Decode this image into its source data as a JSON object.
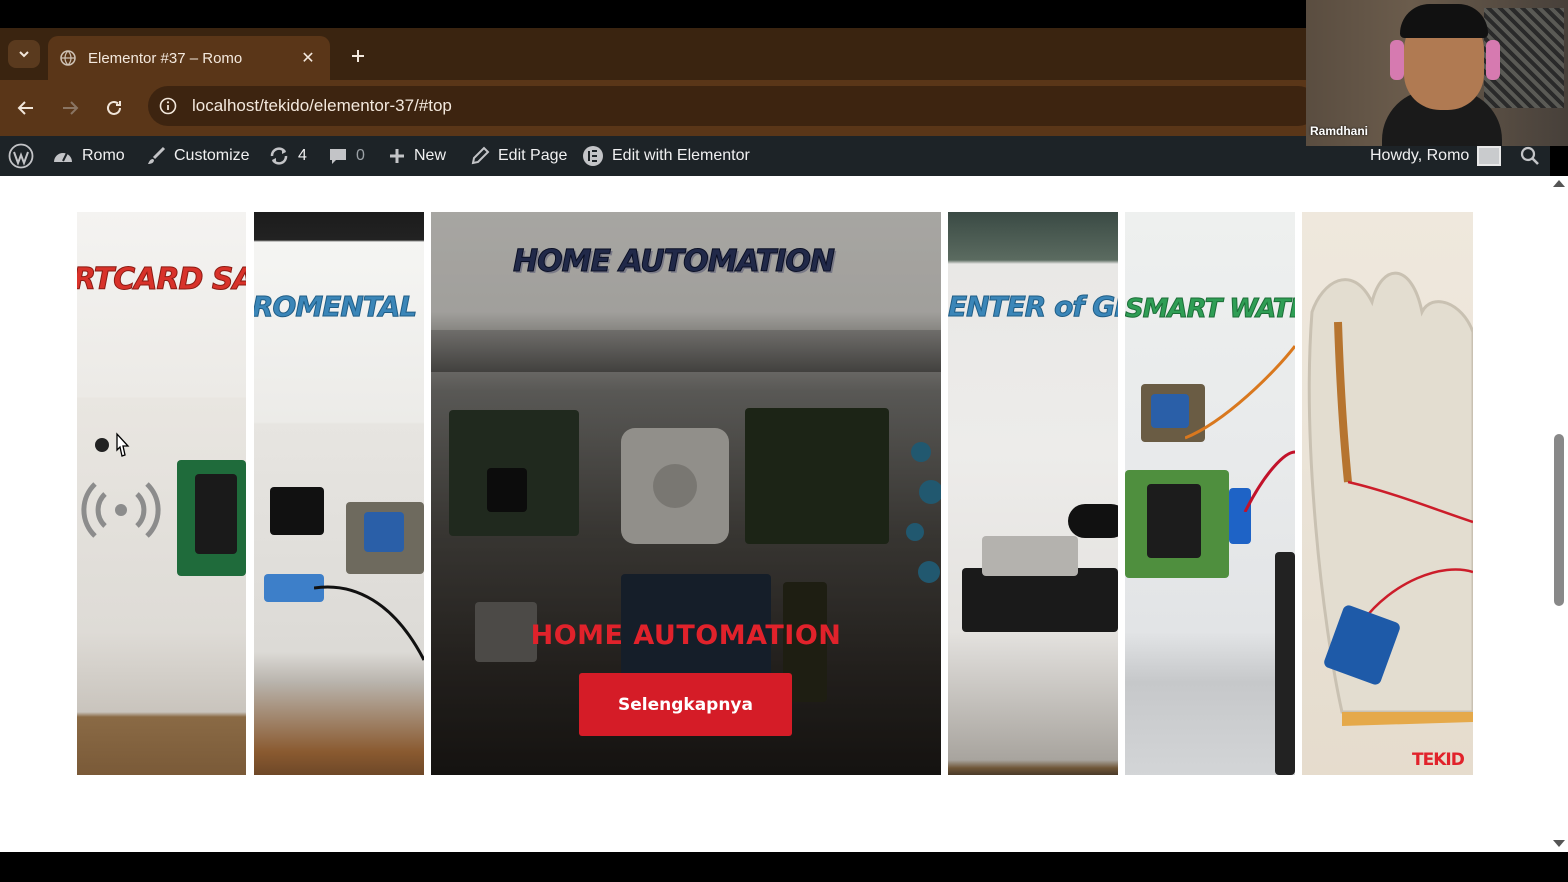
{
  "browser": {
    "tab_title": "Elementor #37 – Romo",
    "url": "localhost/tekido/elementor-37/#top"
  },
  "adminbar": {
    "site_name": "Romo",
    "customize": "Customize",
    "updates_count": "4",
    "comments_count": "0",
    "new": "New",
    "edit_page": "Edit Page",
    "edit_elementor": "Edit with Elementor",
    "howdy": "Howdy, Romo"
  },
  "gallery": {
    "panels": [
      {
        "label": "RTCARD SA",
        "label_color": "#d8322a"
      },
      {
        "label": "ROMENTAL S",
        "label_color": "#3b86b8"
      },
      {
        "label": "HOME AUTOMATION",
        "label_color": "#2e3a66"
      },
      {
        "label": "ENTER of GRA",
        "label_color": "#3b86b8"
      },
      {
        "label": "SMART WATER",
        "label_color": "#2f9e55"
      },
      {
        "label": "TEKID",
        "label_color": "#e1222b"
      }
    ],
    "featured_title": "HOME AUTOMATION",
    "cta_label": "Selengkapnya"
  },
  "webcam": {
    "participant": "Ramdhani"
  },
  "colors": {
    "accent_red": "#d51c27",
    "admin_bar": "#1d2327",
    "browser_frame": "#3a2410"
  }
}
